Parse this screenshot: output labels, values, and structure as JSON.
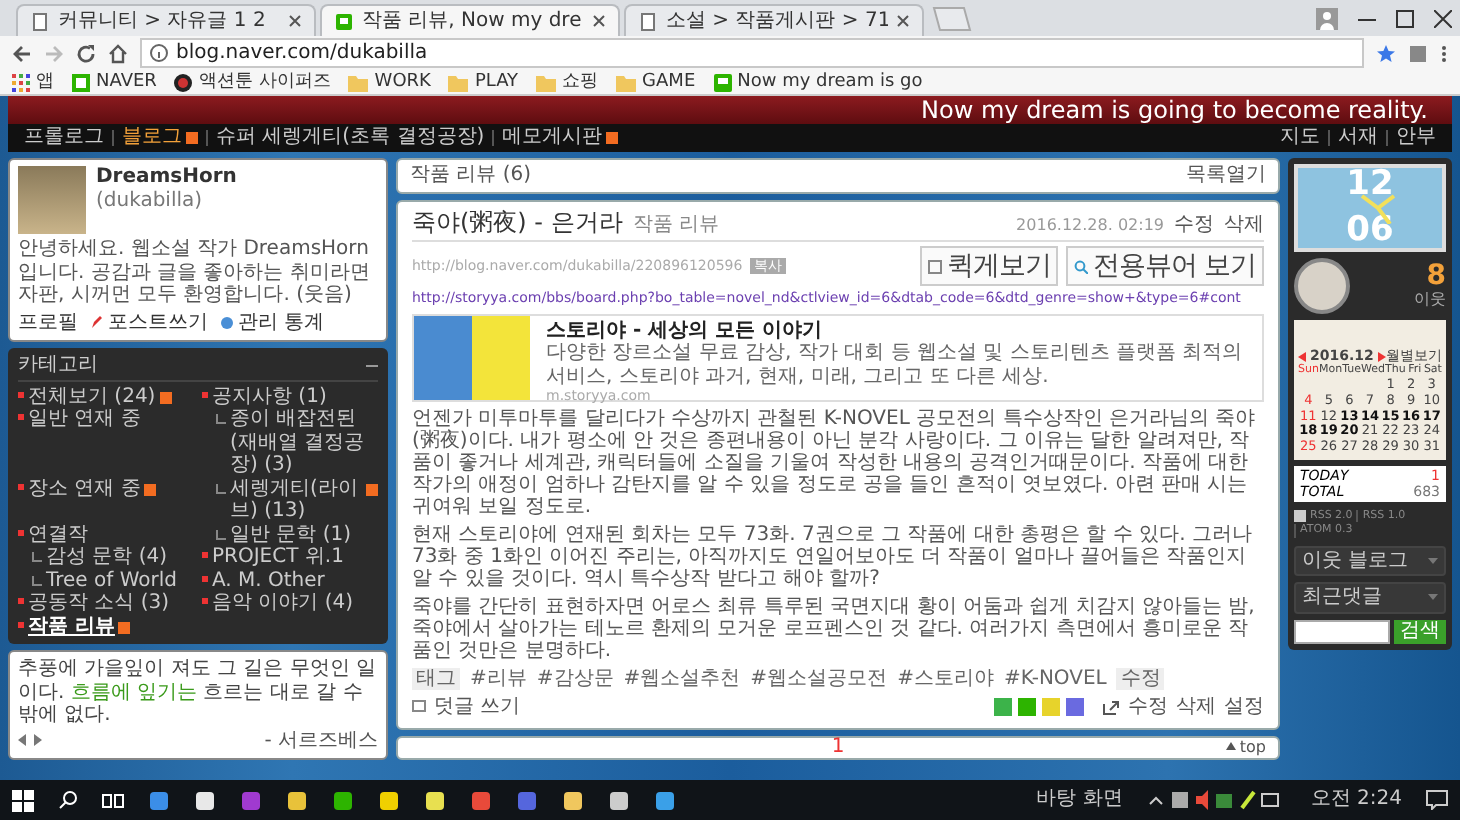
{
  "browser": {
    "tabs": [
      {
        "title": "커뮤니티 > 자유글 1 2",
        "kind": "page",
        "selected": false
      },
      {
        "title": "작품 리뷰, Now my dre",
        "kind": "blog",
        "selected": true
      },
      {
        "title": "소설 > 작품게시판 > 71",
        "kind": "page",
        "selected": false
      }
    ],
    "address": "blog.naver.com/dukabilla",
    "bookmarks": [
      {
        "label": "앱",
        "kind": "apps"
      },
      {
        "label": "NAVER",
        "kind": "naver"
      },
      {
        "label": "액션툰 사이퍼즈",
        "kind": "site"
      },
      {
        "label": "WORK",
        "kind": "folder"
      },
      {
        "label": "PLAY",
        "kind": "folder"
      },
      {
        "label": "쇼핑",
        "kind": "folder"
      },
      {
        "label": "GAME",
        "kind": "folder"
      },
      {
        "label": "Now my dream is go",
        "kind": "blog"
      }
    ]
  },
  "blog": {
    "motto": "Now my dream is going to become reality.",
    "nav_left": [
      {
        "label": "프롤로그",
        "new": false,
        "selected": false
      },
      {
        "label": "블로그",
        "new": true,
        "selected": true
      },
      {
        "label": "슈퍼 세렝게티(초록 결정공장)",
        "new": false,
        "selected": false
      },
      {
        "label": "메모게시판",
        "new": true,
        "selected": false
      }
    ],
    "nav_right": [
      "지도",
      "서재",
      "안부"
    ]
  },
  "profile": {
    "name": "DreamsHorn",
    "id": "(dukabilla)",
    "intro": "안녕하세요. 웹소설 작가 DreamsHorn 입니다. 공감과 글을 좋아하는 취미라면 자판, 시꺼먼 모두 환영합니다. (웃음)",
    "more": "프로필",
    "links": [
      "포스트쓰기",
      "관리 통계"
    ]
  },
  "categories": {
    "title": "카테고리",
    "items": [
      {
        "label": "전체보기",
        "count": "(24)",
        "new": true,
        "selected": false
      },
      {
        "label": "공지사항",
        "count": "(1)",
        "new": false,
        "selected": false
      },
      {
        "label": "일반 연재 중",
        "new": false,
        "selected": false,
        "children": [
          {
            "label": "종이 배잡전된(재배열 결정공장)",
            "count": "(3)",
            "new": false,
            "selected": false
          }
        ]
      },
      {
        "label": "장소 연재 중",
        "new": true,
        "selected": false,
        "children": [
          {
            "label": "세렝게티(라이브)",
            "count": "(13)",
            "new": true,
            "selected": false
          }
        ]
      },
      {
        "label": "연결작",
        "new": false,
        "selected": false,
        "children": [
          {
            "label": "일반 문학",
            "count": "(1)",
            "new": false,
            "selected": false
          },
          {
            "label": "감성 문학",
            "count": "(4)",
            "new": false,
            "selected": false
          }
        ]
      },
      {
        "label": "PROJECT 위.1",
        "new": false,
        "selected": false,
        "children": [
          {
            "label": "Tree of World",
            "new": false,
            "selected": false
          }
        ]
      },
      {
        "label": "A. M. Other",
        "new": false,
        "selected": false
      },
      {
        "label": "공동작 소식",
        "count": "(3)",
        "new": false,
        "selected": false
      },
      {
        "label": "음악 이야기",
        "count": "(4)",
        "new": false,
        "selected": false
      },
      {
        "label": "작품 리뷰",
        "new": true,
        "selected": true
      }
    ]
  },
  "notice": {
    "text": "추풍에 가을잎이 져도 그 길은 무엇인 일이다. **흐름에 잎기는** 흐르는 대로 갈 수 밖에 없다.",
    "author": "- 서르즈베스"
  },
  "post": {
    "list_title": "작품 리뷰",
    "list_count": "(6)",
    "list_toggle": "목록열기",
    "title": "죽야(粥夜) - 은거라",
    "category": "작품 리뷰",
    "date": "2016.12.28. 02:19",
    "actions": [
      "수정",
      "삭제"
    ],
    "url": "http://blog.naver.com/dukabilla/220896120596",
    "copy": "복사",
    "buttons": [
      "퀵게보기",
      "전용뷰어 보기"
    ],
    "link": "http://storyya.com/bbs/board.php?bo_table=novel_nd&ctlview_id=6&dtab_code=6&dtd_genre=show+&type=6#cont",
    "card": {
      "title": "스토리야 - 세상의 모든 이야기",
      "description": "다양한 장르소설 무료 감상, 작가 대회 등 웹소설 및 스토리텐츠 플랫폼 최적의 서비스, 스토리야 과거, 현재, 미래, 그리고 또 다른 세상.",
      "url": "m.storyya.com"
    },
    "paragraphs": [
      "언젠가 미투마투를 달리다가 수상까지 관철된 K-NOVEL 공모전의 특수상작인 은거라님의 죽야(粥夜)이다. 내가 평소에 안 것은 종편내용이 아닌 분각 사랑이다. 그 이유는 달한 알려져만, 작품이 좋거나 세계관, 캐릭터들에 소질을 기울여 작성한 내용의 공격인거때문이다. 작품에 대한 작가의 애정이 엄하나 감탄지를 알 수 있을 정도로 공을 들인 흔적이 엿보였다. 아련 판매 시는 귀여워 보일 정도로.",
      "현재 스토리야에 연재된 회차는 모두 73화. 7권으로 그 작품에 대한 총평은 할 수 있다. 그러나 73화 중 1화인 이어진 주리는, 아직까지도 연일어보아도 더 작품이 얼마나 끌어들은 작품인지 알 수 있을 것이다. 역시 특수상작 받다고 해야 할까?",
      "죽야를 간단히 표현하자면 어로스 최류 특루된 국면지대 황이 어둠과 쉽게 치감지 않아들는 밤, 죽야에서 살아가는 테노르 환제의 모거운 로프펜스인 것 같다. 여러가지 측면에서 흥미로운 작품인 것만은 분명하다."
    ],
    "tag_label": "태그",
    "tags": [
      "#리뷰",
      "#감상문",
      "#웹소설추천",
      "#웹소설공모전",
      "#스토리야",
      "#K-NOVEL"
    ],
    "tag_edit": "수정",
    "comment": "덧글 쓰기",
    "footer_actions": [
      "수정",
      "삭제",
      "설정"
    ],
    "page": "1",
    "top": "top"
  },
  "widgets": {
    "clock_hour": "12",
    "clock_minute": "06",
    "neighbors": "8",
    "neighbors_label": "이웃",
    "calendar": {
      "month": "2016.12",
      "view": "월별보기",
      "weekdays": [
        "Sun",
        "Mon",
        "Tue",
        "Wed",
        "Thu",
        "Fri",
        "Sat"
      ],
      "days": [
        {
          "day": "1",
          "posted": false
        },
        {
          "day": "2",
          "posted": false
        },
        {
          "day": "3",
          "posted": false
        },
        {
          "day": "4",
          "posted": false
        },
        {
          "day": "5",
          "posted": false
        },
        {
          "day": "6",
          "posted": false
        },
        {
          "day": "7",
          "posted": false
        },
        {
          "day": "8",
          "posted": false
        },
        {
          "day": "9",
          "posted": false
        },
        {
          "day": "10",
          "posted": false
        },
        {
          "day": "11",
          "posted": false
        },
        {
          "day": "12",
          "posted": false
        },
        {
          "day": "13",
          "posted": true
        },
        {
          "day": "14",
          "posted": true
        },
        {
          "day": "15",
          "posted": true
        },
        {
          "day": "16",
          "posted": true
        },
        {
          "day": "17",
          "posted": true
        },
        {
          "day": "18",
          "posted": true
        },
        {
          "day": "19",
          "posted": true
        },
        {
          "day": "20",
          "posted": true
        },
        {
          "day": "21",
          "posted": false
        },
        {
          "day": "22",
          "posted": false
        },
        {
          "day": "23",
          "posted": false
        },
        {
          "day": "24",
          "posted": false
        },
        {
          "day": "25",
          "posted": false
        },
        {
          "day": "26",
          "posted": false
        },
        {
          "day": "27",
          "posted": false
        },
        {
          "day": "28",
          "posted": false
        },
        {
          "day": "29",
          "posted": false
        },
        {
          "day": "30",
          "posted": false
        },
        {
          "day": "31",
          "posted": false
        }
      ]
    },
    "today_label": "TODAY",
    "today": "1",
    "total_label": "TOTAL",
    "total": "683",
    "feeds": [
      "RSS 2.0",
      "RSS 1.0",
      "ATOM 0.3"
    ],
    "panels": [
      "이웃 블로그",
      "최근댓글"
    ],
    "search_button": "검색"
  },
  "taskbar": {
    "tray_label": "바탕 화면",
    "time": "오전 2:24"
  }
}
